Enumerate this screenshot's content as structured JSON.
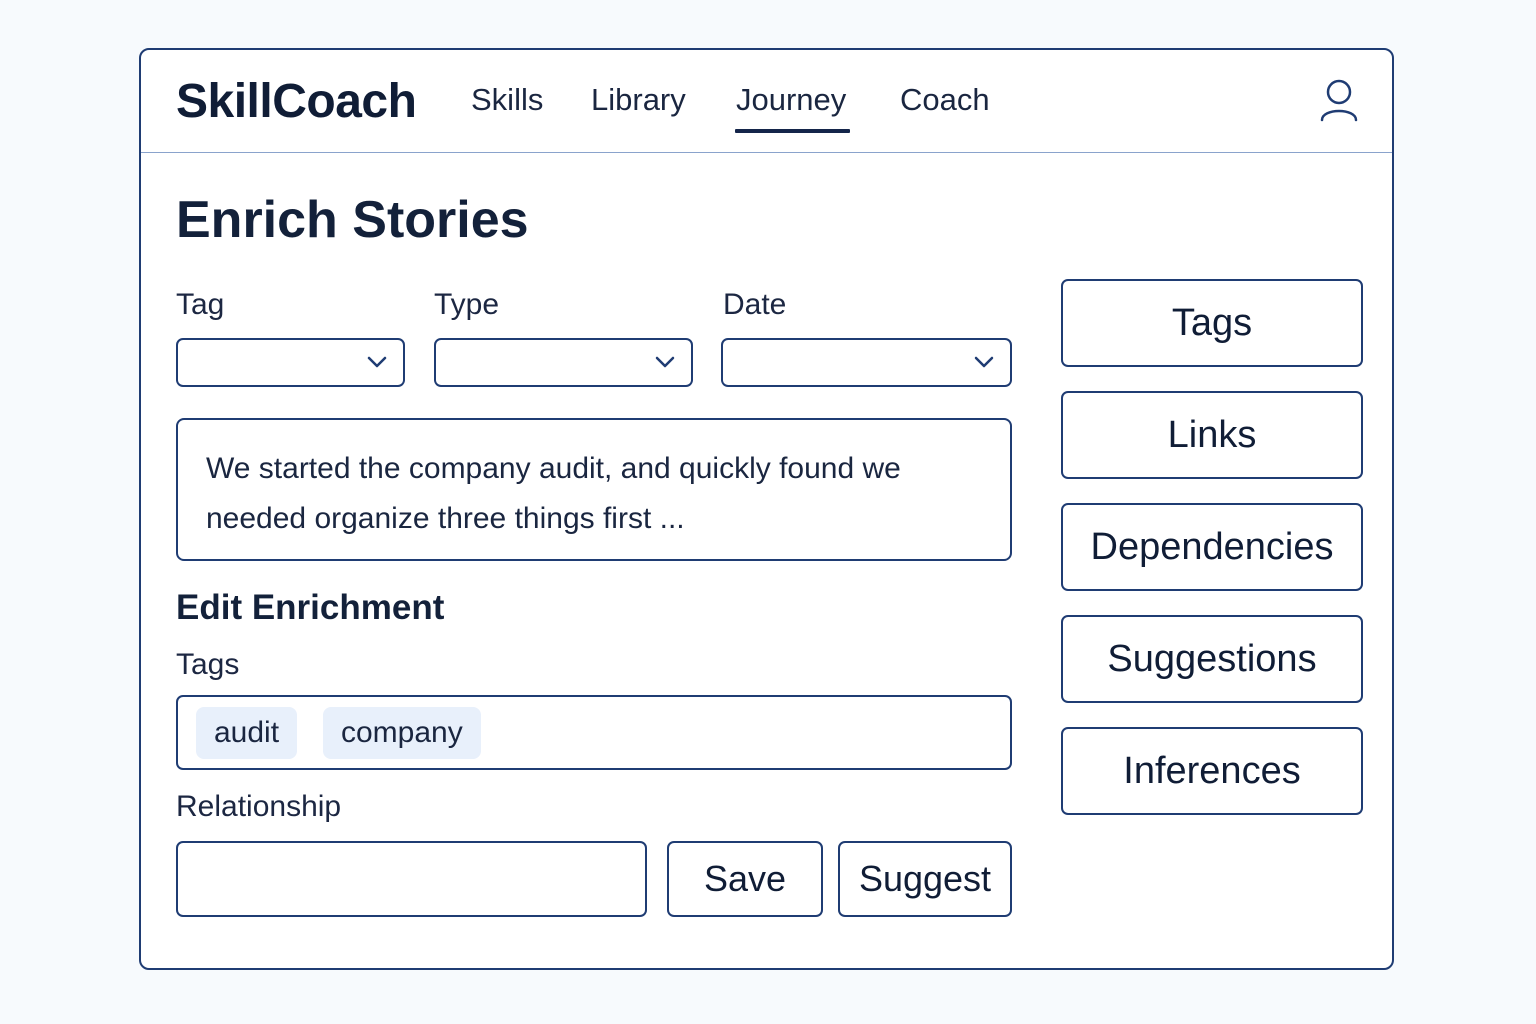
{
  "app": {
    "name": "SkillCoach"
  },
  "nav": {
    "items": [
      {
        "label": "Skills"
      },
      {
        "label": "Library"
      },
      {
        "label": "Journey",
        "active": true
      },
      {
        "label": "Coach"
      }
    ]
  },
  "page": {
    "title": "Enrich Stories"
  },
  "filters": {
    "tag": {
      "label": "Tag",
      "value": ""
    },
    "type": {
      "label": "Type",
      "value": ""
    },
    "date": {
      "label": "Date",
      "value": ""
    }
  },
  "story": {
    "text": "We started the company audit, and quickly found we needed organize three things first ..."
  },
  "enrichment": {
    "title": "Edit Enrichment",
    "tags_label": "Tags",
    "tags": [
      "audit",
      "company"
    ],
    "relationship_label": "Relationship",
    "relationship_value": "",
    "save_label": "Save",
    "suggest_label": "Suggest"
  },
  "side_panel": {
    "buttons": [
      "Tags",
      "Links",
      "Dependencies",
      "Suggestions",
      "Inferences"
    ]
  },
  "colors": {
    "accent": "#1f3c73",
    "chip_bg": "#e8f0fb",
    "text": "#13213a",
    "page_bg": "#f7fafd"
  },
  "icons": {
    "user": "user-icon",
    "dropdown": "chevron-down-icon"
  }
}
